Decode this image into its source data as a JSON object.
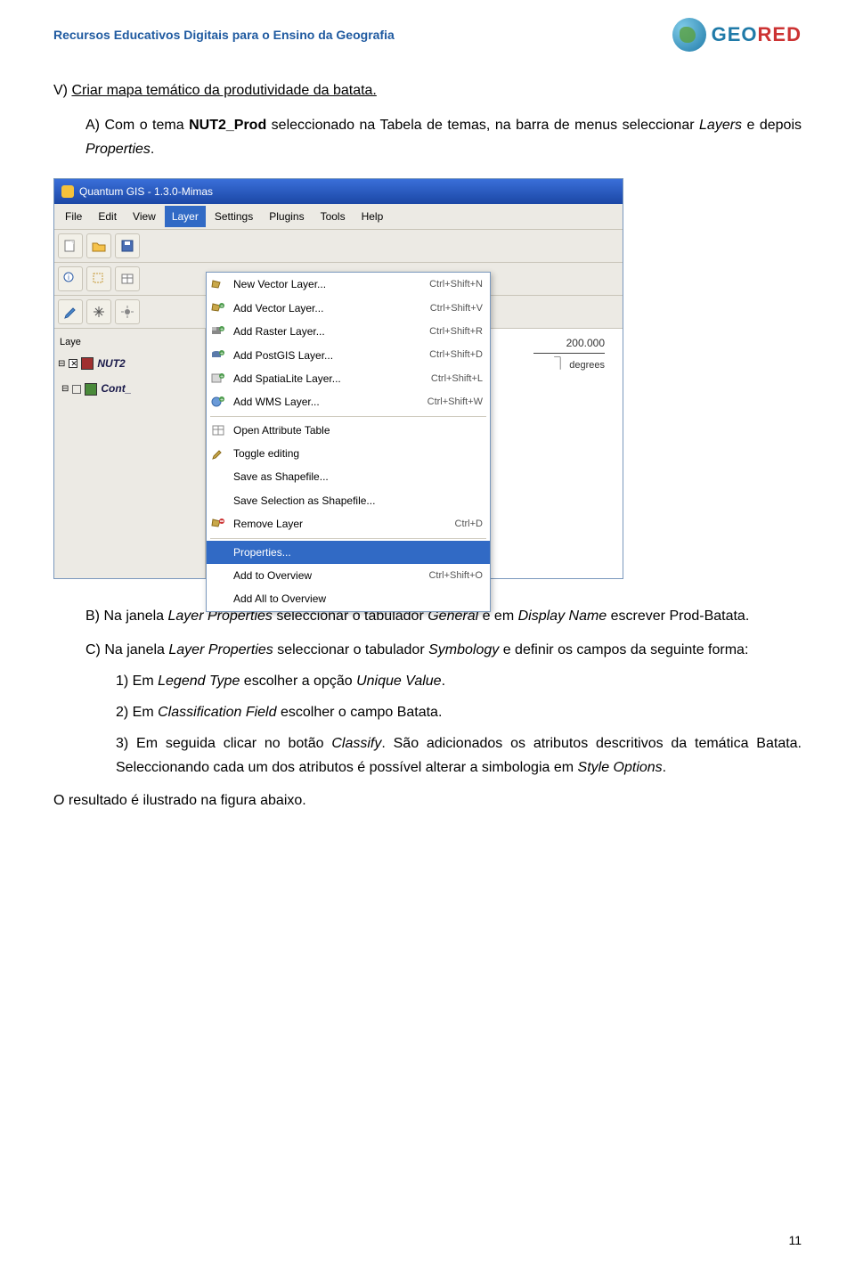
{
  "header": {
    "title": "Recursos Educativos Digitais para o Ensino da Geografia",
    "logo_geo": "GEO",
    "logo_red": "RED"
  },
  "section_v": {
    "prefix": "V) ",
    "text": "Criar mapa temático da produtividade da batata."
  },
  "section_a": {
    "prefix": "A) Com o tema ",
    "bold": "NUT2_Prod",
    "mid": " seleccionado na Tabela de temas, na barra de menus seleccionar ",
    "italic1": "Layers",
    "mid2": " e depois ",
    "italic2": "Properties",
    "end": "."
  },
  "app": {
    "title": "Quantum GIS - 1.3.0-Mimas",
    "menus": [
      "File",
      "Edit",
      "View",
      "Layer",
      "Settings",
      "Plugins",
      "Tools",
      "Help"
    ],
    "layers_label": "Laye",
    "tree": {
      "nut2": "NUT2",
      "cont": "Cont_"
    },
    "dropdown": [
      {
        "icon": "new-vector",
        "label": "New Vector Layer...",
        "shortcut": "Ctrl+Shift+N"
      },
      {
        "icon": "add-vector",
        "label": "Add Vector Layer...",
        "shortcut": "Ctrl+Shift+V"
      },
      {
        "icon": "add-raster",
        "label": "Add Raster Layer...",
        "shortcut": "Ctrl+Shift+R"
      },
      {
        "icon": "add-postgis",
        "label": "Add PostGIS Layer...",
        "shortcut": "Ctrl+Shift+D"
      },
      {
        "icon": "add-spatialite",
        "label": "Add SpatiaLite Layer...",
        "shortcut": "Ctrl+Shift+L"
      },
      {
        "icon": "add-wms",
        "label": "Add WMS Layer...",
        "shortcut": "Ctrl+Shift+W"
      },
      {
        "sep": true
      },
      {
        "icon": "",
        "label": "Open Attribute Table",
        "shortcut": ""
      },
      {
        "icon": "",
        "label": "Toggle editing",
        "shortcut": ""
      },
      {
        "icon": "",
        "label": "Save as Shapefile...",
        "shortcut": ""
      },
      {
        "icon": "",
        "label": "Save Selection as Shapefile...",
        "shortcut": ""
      },
      {
        "icon": "remove",
        "label": "Remove Layer",
        "shortcut": "Ctrl+D"
      },
      {
        "sep": true
      },
      {
        "icon": "",
        "label": "Properties...",
        "shortcut": "",
        "highlight": true
      },
      {
        "icon": "",
        "label": "Add to Overview",
        "shortcut": "Ctrl+Shift+O"
      },
      {
        "icon": "",
        "label": "Add All to Overview",
        "shortcut": ""
      }
    ],
    "scale_value": "200.000",
    "scale_unit": "degrees"
  },
  "section_b": {
    "prefix": "B) Na janela ",
    "i1": "Layer Properties",
    "mid1": " seleccionar o tabulador ",
    "i2": "General",
    "mid2": " e em ",
    "i3": "Display Name",
    "mid3": " escrever Prod-Batata."
  },
  "section_c": {
    "prefix": "C) Na janela ",
    "i1": "Layer Properties",
    "mid1": " seleccionar o tabulador ",
    "i2": "Symbology",
    "mid2": " e definir os campos da seguinte forma:"
  },
  "list": {
    "item1": {
      "pre": "1)  Em ",
      "i": "Legend Type",
      "post": " escolher a opção ",
      "i2": "Unique Value",
      "end": "."
    },
    "item2": {
      "pre": "2)  Em ",
      "i": "Classification Field",
      "post": " escolher o campo Batata."
    },
    "item3": {
      "pre": "3)  Em seguida clicar no botão ",
      "i": "Classify",
      "post": ". São adicionados os atributos descritivos da temática Batata. Seleccionando cada um dos atributos é possível alterar a simbologia em ",
      "i2": "Style Options",
      "end": "."
    }
  },
  "result_line": "O resultado é ilustrado na figura abaixo.",
  "page_number": "11"
}
